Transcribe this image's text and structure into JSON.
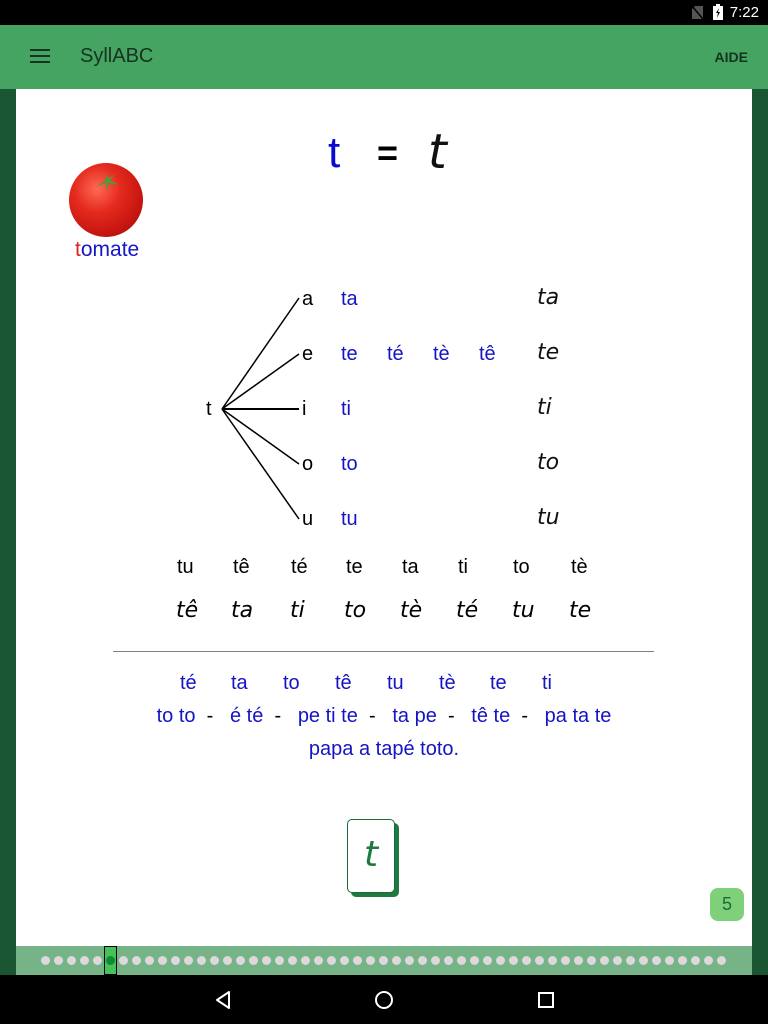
{
  "status_bar": {
    "time": "7:22",
    "icons": [
      "no-sim-icon",
      "battery-charging-icon"
    ]
  },
  "app_bar": {
    "menu_icon": "hamburger-menu-icon",
    "title": "SyllABC",
    "action": "AIDE"
  },
  "lesson": {
    "print_letter": "t",
    "equals": "=",
    "cursive_letter": "t",
    "picture": "tomato-image",
    "word_highlight": "t",
    "word_rest": "omate"
  },
  "tree": {
    "root": "t",
    "rows": [
      {
        "vowel": "a",
        "syllables": [
          "ta"
        ],
        "cursive": "ta"
      },
      {
        "vowel": "e",
        "syllables": [
          "te",
          "té",
          "tè",
          "tê"
        ],
        "cursive": "te"
      },
      {
        "vowel": "i",
        "syllables": [
          "ti"
        ],
        "cursive": "ti"
      },
      {
        "vowel": "o",
        "syllables": [
          "to"
        ],
        "cursive": "to"
      },
      {
        "vowel": "u",
        "syllables": [
          "tu"
        ],
        "cursive": "tu"
      }
    ]
  },
  "mixed_print": [
    "tu",
    "tê",
    "té",
    "te",
    "ta",
    "ti",
    "to",
    "tè"
  ],
  "mixed_cursive": [
    "tê",
    "ta",
    "ti",
    "to",
    "tè",
    "té",
    "tu",
    "te"
  ],
  "reading": {
    "syllables": [
      "té",
      "ta",
      "to",
      "tê",
      "tu",
      "tè",
      "te",
      "ti"
    ],
    "words": [
      "to to",
      "é té",
      "pe ti te",
      "ta pe",
      "tê te",
      "pa ta te"
    ],
    "separator": "-",
    "sentence": "papa a tapé toto."
  },
  "card": {
    "letter": "t"
  },
  "page_number": "5",
  "pager": {
    "total": 53,
    "active_index": 5
  },
  "nav_bar": {
    "icons": [
      "back-icon",
      "home-icon",
      "recents-icon"
    ]
  },
  "colors": {
    "app_bar": "#45a462",
    "frame": "#1b5632",
    "syllable_blue": "#1414c4",
    "highlight_red": "#e0241b",
    "badge": "#7ed07a"
  }
}
